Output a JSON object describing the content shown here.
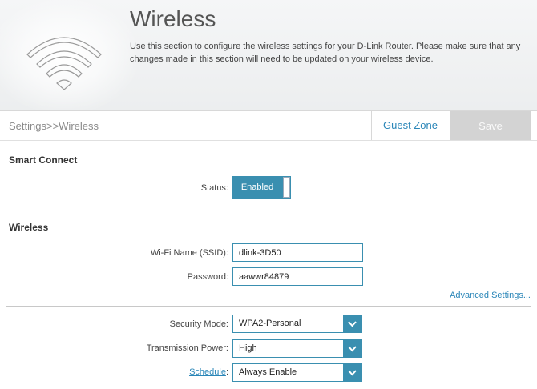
{
  "header": {
    "title": "Wireless",
    "description": "Use this section to configure the wireless settings for your D-Link Router. Please make sure that any changes made in this section will need to be updated on your wireless device.",
    "logo_icon": "wifi-icon"
  },
  "bar": {
    "breadcrumb": "Settings>>Wireless",
    "guest_zone_label": "Guest Zone",
    "save_label": "Save"
  },
  "smart_connect": {
    "title": "Smart Connect",
    "status_label": "Status:",
    "status_value": "Enabled"
  },
  "wireless": {
    "title": "Wireless",
    "ssid_label": "Wi-Fi Name (SSID):",
    "ssid_value": "dlink-3D50",
    "password_label": "Password:",
    "password_value": "aawwr84879",
    "advanced_link": "Advanced Settings...",
    "security_mode_label": "Security Mode:",
    "security_mode_value": "WPA2-Personal",
    "tx_power_label": "Transmission Power:",
    "tx_power_value": "High",
    "schedule_link": "Schedule",
    "schedule_colon": ":",
    "schedule_value": "Always Enable"
  },
  "colors": {
    "accent": "#3a8fb0",
    "link": "#2a86b8",
    "save_disabled": "#d3d3d3"
  }
}
